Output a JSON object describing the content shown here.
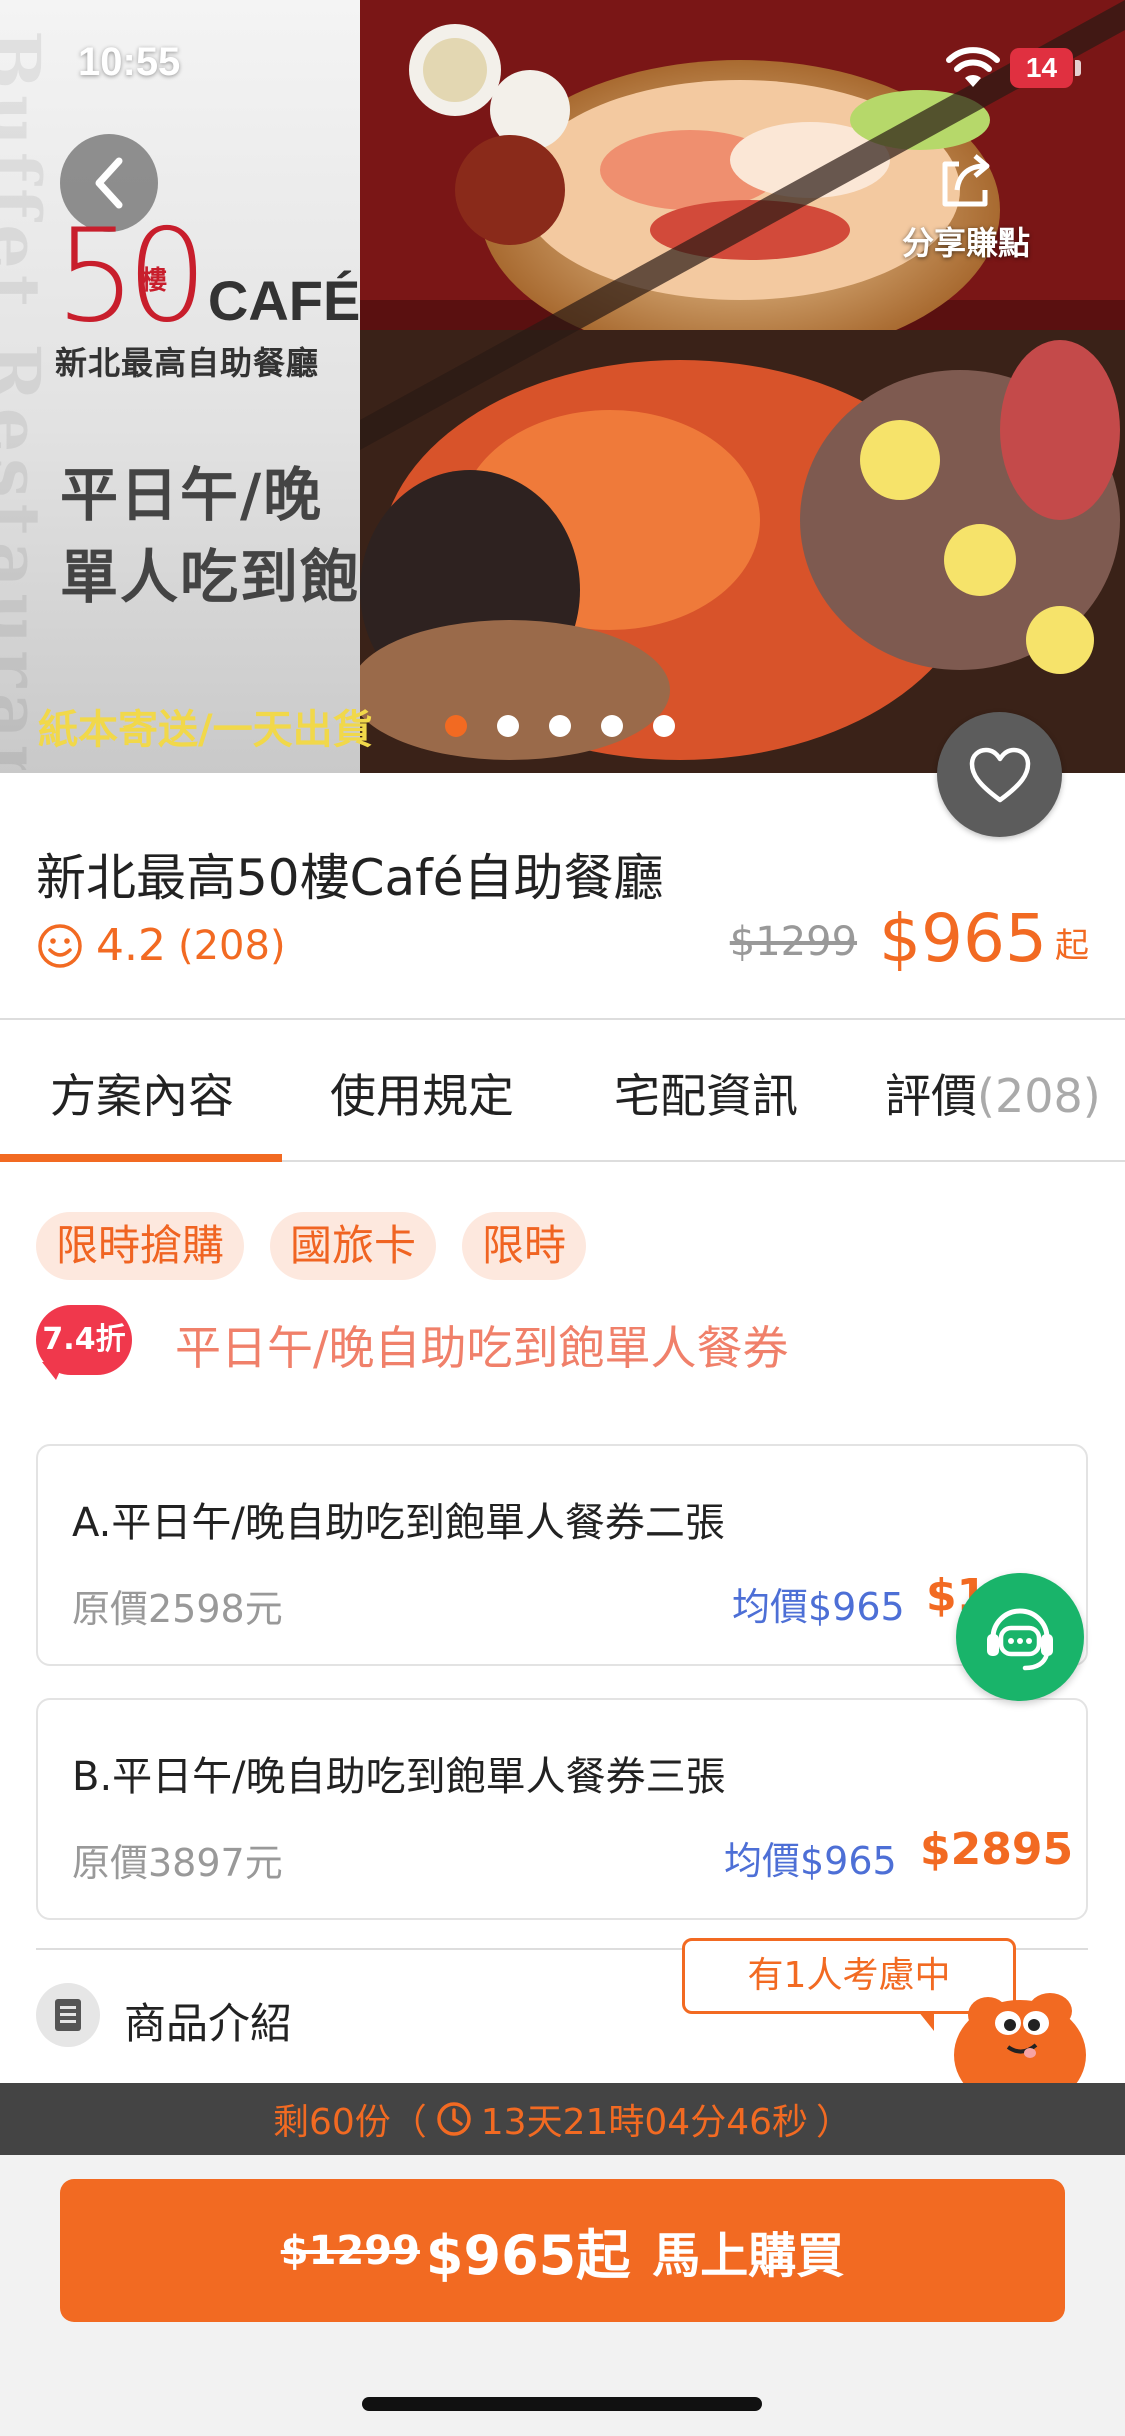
{
  "status_bar": {
    "time": "10:55",
    "battery": "14"
  },
  "hero": {
    "watermark": "Buffet Restaurant",
    "logo_number": "50",
    "logo_floor": "樓",
    "logo_cafe": "CAFÉ",
    "logo_subtitle": "新北最高自助餐廳",
    "promo_line1": "平日午/晚",
    "promo_line2": "單人吃到飽",
    "delivery_note": "紙本寄送/一天出貨",
    "share_label": "分享賺點",
    "carousel_count": 5,
    "carousel_active": 0
  },
  "product": {
    "title": "新北最高50樓Café自助餐廳",
    "rating": "4.2",
    "review_count": "(208)",
    "original_price": "$1299",
    "price": "$965",
    "price_suffix": "起"
  },
  "tabs": [
    {
      "label": "方案內容",
      "extra": ""
    },
    {
      "label": "使用規定",
      "extra": ""
    },
    {
      "label": "宅配資訊",
      "extra": ""
    },
    {
      "label": "評價",
      "extra": "(208)"
    }
  ],
  "tags": [
    "限時搶購",
    "國旅卡",
    "限時"
  ],
  "plan": {
    "discount_badge": "7.4折",
    "title": "平日午/晚自助吃到飽單人餐券"
  },
  "options": [
    {
      "name": "A.平日午/晚自助吃到飽單人餐券二張",
      "original": "原價2598元",
      "avg_price": "均價$965",
      "price": "$19"
    },
    {
      "name": "B.平日午/晚自助吃到飽單人餐券三張",
      "original": "原價3897元",
      "avg_price": "均價$965",
      "price": "$2895"
    }
  ],
  "intro": {
    "label": "商品介紹"
  },
  "considering": "有1人考慮中",
  "countdown": {
    "prefix": "剩60份（",
    "time": "13天21時04分46秒",
    "suffix": "）"
  },
  "buy": {
    "old_price": "$1299",
    "new_price": "$965起",
    "label": "馬上購買"
  },
  "colors": {
    "accent": "#f26a22",
    "chat": "#19b46a",
    "tag_bg": "#fde8de",
    "badge": "#f0384c",
    "avg_price": "#4d6fd6"
  }
}
